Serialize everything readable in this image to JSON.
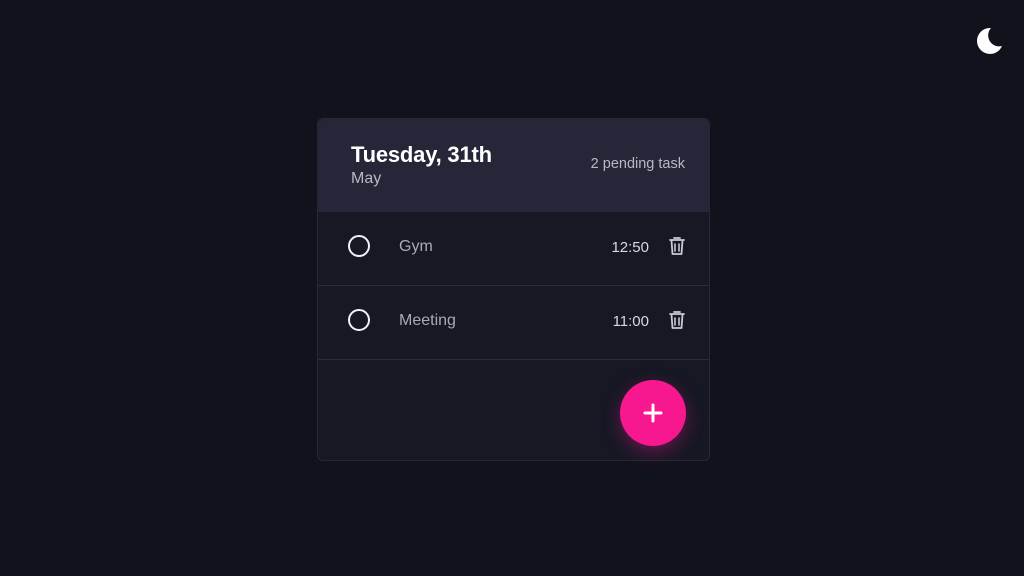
{
  "theme_toggle": {
    "icon": "moon-icon"
  },
  "header": {
    "date": "Tuesday, 31th",
    "month": "May",
    "pending": "2 pending task"
  },
  "tasks": [
    {
      "name": "Gym",
      "time": "12:50",
      "done": false
    },
    {
      "name": "Meeting",
      "time": "11:00",
      "done": false
    }
  ],
  "add_button": {
    "icon": "plus-icon"
  },
  "colors": {
    "background": "#11131c",
    "card": "#161824",
    "header": "#252738",
    "accent": "#f7188f"
  }
}
